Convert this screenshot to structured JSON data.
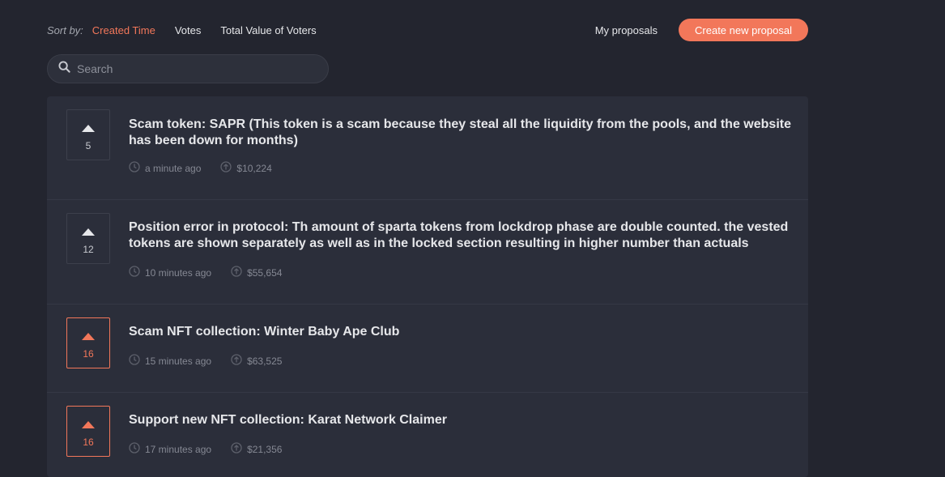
{
  "toolbar": {
    "sort_label": "Sort by:",
    "sort_options": [
      "Created Time",
      "Votes",
      "Total Value of Voters"
    ],
    "active_sort": "Created Time",
    "my_proposals": "My proposals",
    "create_button": "Create new proposal"
  },
  "search": {
    "placeholder": "Search",
    "value": ""
  },
  "colors": {
    "accent": "#f2775a",
    "background": "#23252f",
    "panel": "#2b2e3a"
  },
  "proposals": [
    {
      "votes": "5",
      "voted": false,
      "title": "Scam token: SAPR (This token is a scam because they steal all the liquidity from the pools, and the website has been down for months)",
      "time": "a minute ago",
      "value": "$10,224"
    },
    {
      "votes": "12",
      "voted": false,
      "title": "Position error in protocol: Th amount of sparta tokens from lockdrop phase are double counted. the vested tokens are shown separately as well as in the locked section resulting in higher number than actuals",
      "time": "10 minutes ago",
      "value": "$55,654"
    },
    {
      "votes": "16",
      "voted": true,
      "title": "Scam NFT collection: Winter Baby Ape Club",
      "time": "15 minutes ago",
      "value": "$63,525"
    },
    {
      "votes": "16",
      "voted": true,
      "title": "Support new NFT collection: Karat Network Claimer",
      "time": "17 minutes ago",
      "value": "$21,356"
    }
  ]
}
